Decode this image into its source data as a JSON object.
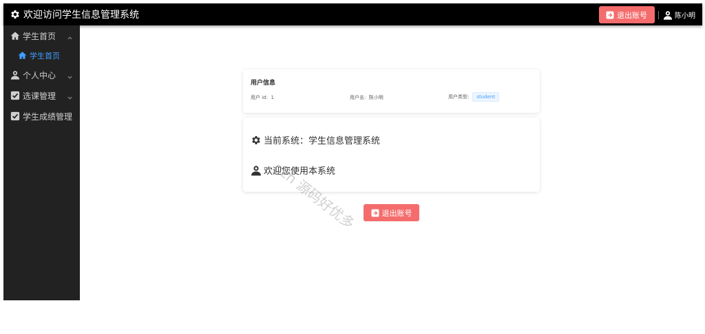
{
  "header": {
    "title": "欢迎访问学生信息管理系统",
    "logout_label": "退出账号",
    "username": "陈小明",
    "logo_icon": "gear-icon",
    "background": "#000000"
  },
  "sidebar": {
    "items": [
      {
        "label": "学生首页",
        "icon": "home-icon",
        "expanded": true
      },
      {
        "label": "学生首页",
        "icon": "home-icon",
        "active": true
      },
      {
        "label": "个人中心",
        "icon": "user-icon",
        "expanded": false
      },
      {
        "label": "选课管理",
        "icon": "checkbox-icon",
        "expanded": false
      },
      {
        "label": "学生成绩管理",
        "icon": "checkbox-icon"
      }
    ],
    "active_color": "#409eff"
  },
  "user_info": {
    "title": "用户信息",
    "id_label": "用户 id:",
    "id_value": "1",
    "name_label": "用户名:",
    "name_value": "陈小明",
    "type_label": "用户类型:",
    "type_value": "student"
  },
  "system": {
    "current_label": "当前系统：学生信息管理系统",
    "welcome": "欢迎您使用本系统"
  },
  "main": {
    "logout_label": "退出账号"
  },
  "watermark": "gzh 源码好优多",
  "colors": {
    "danger": "#f56c6c",
    "primary": "#409eff"
  }
}
